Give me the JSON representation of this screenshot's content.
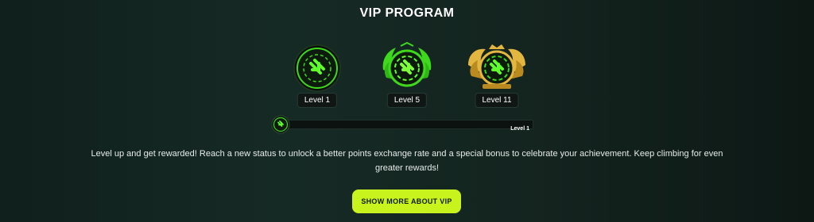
{
  "vip": {
    "title": "VIP PROGRAM",
    "badges": [
      {
        "label": "Level 1",
        "icon": "chip-level-1-icon"
      },
      {
        "label": "Level 5",
        "icon": "chip-laurel-level-5-icon"
      },
      {
        "label": "Level 11",
        "icon": "chip-gold-wings-level-11-icon"
      }
    ],
    "progress": {
      "current_level": "Level 1",
      "progress": 0
    },
    "description": "Level up and get rewarded! Reach a new status to unlock a better points exchange rate and a special bonus to celebrate your achievement. Keep climbing for even greater rewards!",
    "cta_label": "SHOW MORE ABOUT VIP"
  },
  "colors": {
    "accent": "#c8f31d",
    "bright_green": "#3ed81c",
    "background": "#152822",
    "gold": "#e3b640"
  }
}
